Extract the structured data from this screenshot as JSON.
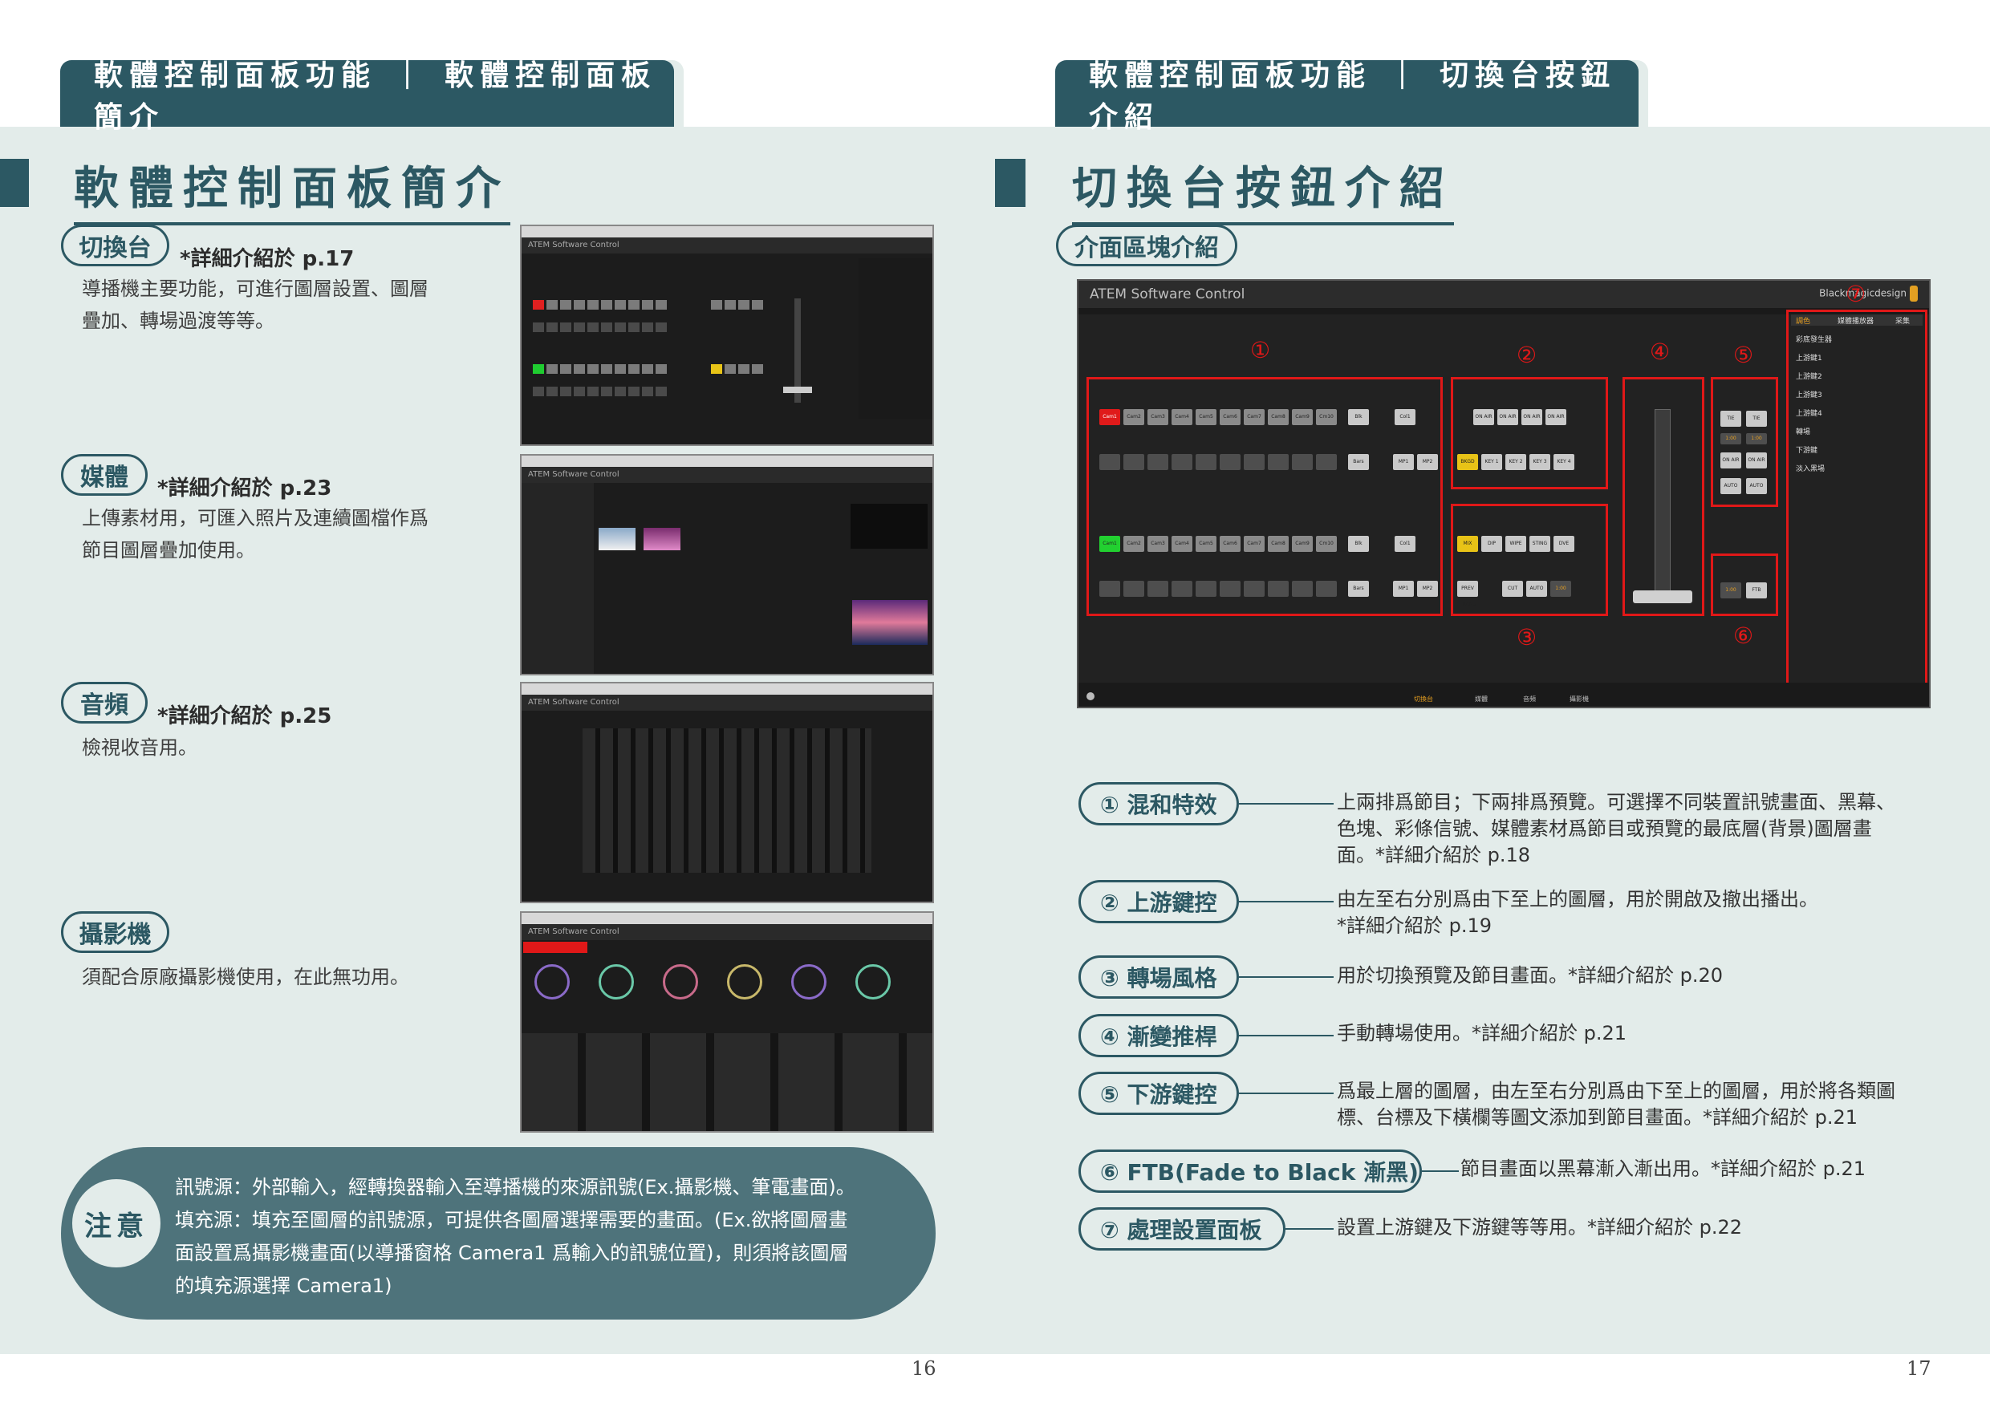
{
  "left_page": {
    "header": "軟體控制面板功能 ｜ 軟體控制面板簡介",
    "title": "軟體控制面板簡介",
    "sections": [
      {
        "label": "切換台",
        "ref": "*詳細介紹於 p.17",
        "desc": [
          "導播機主要功能，可進行圖層設置、圖層",
          "疊加、轉場過渡等等。"
        ]
      },
      {
        "label": "媒體",
        "ref": "*詳細介紹於 p.23",
        "desc": [
          "上傳素材用，可匯入照片及連續圖檔作爲",
          "節目圖層疊加使用。"
        ]
      },
      {
        "label": "音頻",
        "ref": "*詳細介紹於 p.25",
        "desc": [
          "檢視收音用。"
        ]
      },
      {
        "label": "攝影機",
        "ref": "",
        "desc": [
          "須配合原廠攝影機使用，在此無功用。"
        ]
      }
    ],
    "shot_titles": [
      "ATEM Software Control",
      "ATEM Software Control",
      "ATEM Software Control",
      "ATEM Software Control"
    ],
    "note": {
      "label": "注意",
      "lines": [
        "訊號源：外部輸入，經轉換器輸入至導播機的來源訊號(Ex.攝影機、筆電畫面)。",
        "填充源：填充至圖層的訊號源，可提供各圖層選擇需要的畫面。(Ex.欲將圖層畫",
        "面設置爲攝影機畫面(以導播窗格 Camera1 爲輸入的訊號位置)，則須將該圖層",
        "的填充源選擇 Camera1)"
      ]
    },
    "page_number": "16"
  },
  "right_page": {
    "header": "軟體控制面板功能 ｜ 切換台按鈕介紹",
    "title": "切換台按鈕介紹",
    "subsection": "介面區塊介紹",
    "screenshot": {
      "title": "ATEM Software Control",
      "logo": "Blackmagicdesign",
      "region_numbers": [
        "①",
        "②",
        "③",
        "④",
        "⑤",
        "⑥",
        "⑦"
      ],
      "program_buttons": [
        "Cam1",
        "Cam2",
        "Cam3",
        "Cam4",
        "Cam5",
        "Cam6",
        "Cam7",
        "Cam8",
        "Cam9",
        "Cm10",
        "Blk",
        "Col1"
      ],
      "preview_buttons": [
        "Cam1",
        "Cam2",
        "Cam3",
        "Cam4",
        "Cam5",
        "Cam6",
        "Cam7",
        "Cam8",
        "Cam9",
        "Cm10",
        "Blk",
        "Col1"
      ],
      "second_row_end": [
        "Bars",
        "MP1",
        "MP2"
      ],
      "upstream_on_air": [
        "ON AIR",
        "ON AIR",
        "ON AIR",
        "ON AIR"
      ],
      "upstream_keys": [
        "BKGD",
        "KEY 1",
        "KEY 2",
        "KEY 3",
        "KEY 4"
      ],
      "transition_styles": [
        "MIX",
        "DIP",
        "WIPE",
        "STING",
        "DVE"
      ],
      "transition_controls": [
        "PREV TRANS",
        "CUT",
        "AUTO"
      ],
      "transition_rate": "1:00",
      "dsk_labels": [
        "TIE",
        "TIE",
        "ON AIR",
        "ON AIR",
        "AUTO",
        "AUTO"
      ],
      "dsk_rates": [
        "1:00",
        "1:00"
      ],
      "ftb_rate": "1:00",
      "ftb_label": "FTB",
      "side_tabs": [
        "調色",
        "媒體播放器",
        "采集"
      ],
      "side_items": [
        "彩底發生器",
        "上游鍵1",
        "上游鍵2",
        "上游鍵3",
        "上游鍵4",
        "轉場",
        "下游鍵",
        "淡入黑場"
      ],
      "footer_tabs": [
        "切換台",
        "媒體",
        "音頻",
        "攝影機"
      ]
    },
    "features": [
      {
        "label": "① 混和特效",
        "text": [
          "上兩排爲節目；下兩排爲預覽。可選擇不同裝置訊號畫面、黑幕、",
          "色塊、彩條信號、媒體素材爲節目或預覽的最底層(背景)圖層畫",
          "面。*詳細介紹於 p.18"
        ]
      },
      {
        "label": "② 上游鍵控",
        "text": [
          "由左至右分別爲由下至上的圖層，用於開啟及撤出播出。",
          "*詳細介紹於 p.19"
        ]
      },
      {
        "label": "③ 轉場風格",
        "text": [
          "用於切換預覽及節目畫面。*詳細介紹於 p.20"
        ]
      },
      {
        "label": "④ 漸變推桿",
        "text": [
          "手動轉場使用。*詳細介紹於 p.21"
        ]
      },
      {
        "label": "⑤ 下游鍵控",
        "text": [
          "爲最上層的圖層，由左至右分別爲由下至上的圖層，用於將各類圖",
          "標、台標及下橫欄等圖文添加到節目畫面。*詳細介紹於 p.21"
        ]
      },
      {
        "label": "⑥ FTB(Fade to Black 漸黑)",
        "text": [
          "節目畫面以黑幕漸入漸出用。*詳細介紹於 p.21"
        ]
      },
      {
        "label": "⑦ 處理設置面板",
        "text": [
          "設置上游鍵及下游鍵等等用。*詳細介紹於 p.22"
        ]
      }
    ],
    "page_number": "17"
  },
  "colors": {
    "accent": "#2c5863",
    "background": "#e3ecea",
    "note": "#4e737b",
    "highlight_red": "#e01818"
  }
}
